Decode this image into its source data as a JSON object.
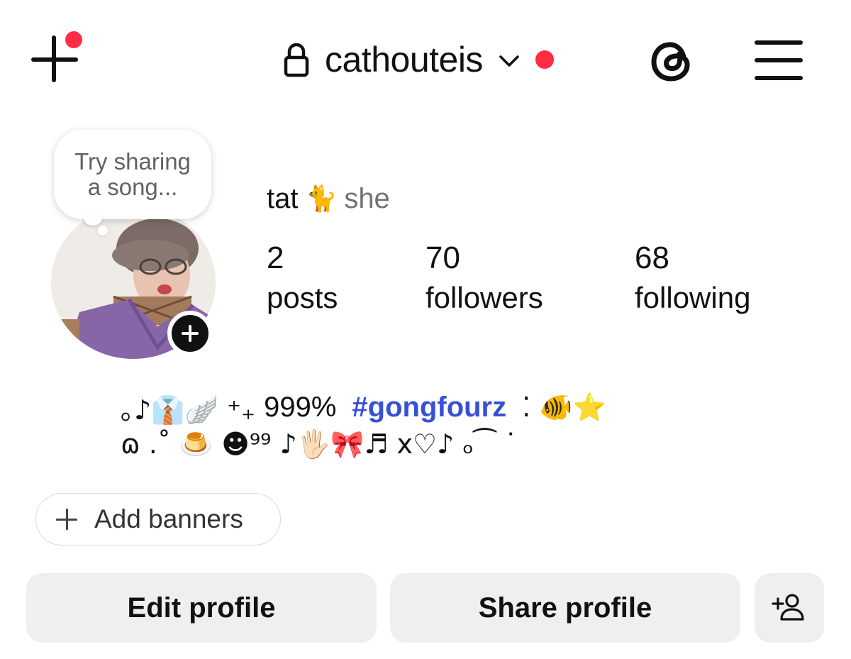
{
  "header": {
    "username": "cathouteis",
    "has_new_post_notification": true,
    "has_account_notification": true,
    "accent_color": "#ff2d43"
  },
  "note": {
    "line1": "Try sharing",
    "line2": "a song..."
  },
  "profile": {
    "display_name": "tat",
    "name_emoji": "🐈",
    "pronouns": "she"
  },
  "stats": {
    "posts": {
      "value": "2",
      "label": "posts"
    },
    "followers": {
      "value": "70",
      "label": "followers"
    },
    "following": {
      "value": "68",
      "label": "following"
    }
  },
  "bio": {
    "line1_prefix": "｡♪👔🪽 ⁺₊",
    "line1_text": "999%",
    "hashtag": "#gongfourz",
    "line1_suffix": "⁚ 🐠⭐",
    "line2": "ɷ .˚ 🍮 ☻⁹⁹ ♪🖐🏻🎀♬ x♡♪ ₒ⁀ ˙"
  },
  "actions": {
    "add_banners": "Add banners",
    "edit_profile": "Edit profile",
    "share_profile": "Share profile"
  },
  "icons": {
    "new_post": "plus-icon",
    "lock": "lock-icon",
    "chevron": "chevron-down-icon",
    "threads": "threads-icon",
    "menu": "hamburger-menu-icon",
    "discover": "add-person-icon"
  },
  "colors": {
    "hashtag": "#3850d6",
    "button_bg": "#efefef",
    "muted_text": "#737373"
  }
}
